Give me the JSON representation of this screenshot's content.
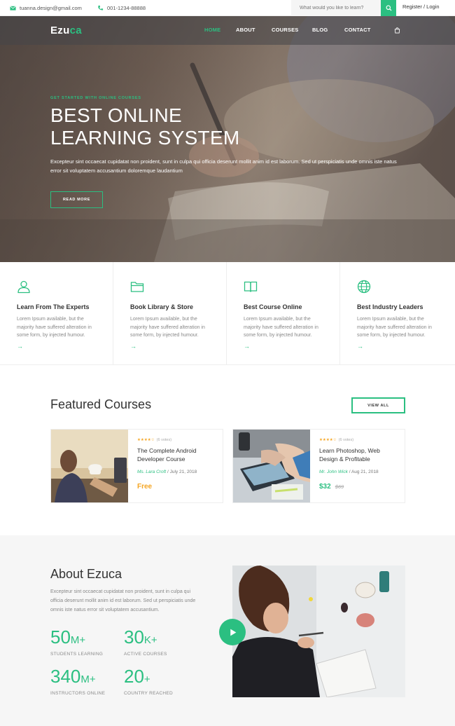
{
  "topbar": {
    "email": "tuanna.design@gmail.com",
    "phone": "001-1234-88888",
    "search_placeholder": "What would you like to learn?",
    "register_login": "Register / Login"
  },
  "nav": {
    "logo_a": "Ezu",
    "logo_b": "ca",
    "items": [
      "HOME",
      "ABOUT",
      "COURSES",
      "BLOG",
      "CONTACT"
    ]
  },
  "hero": {
    "eyebrow": "GET STARTED WITH ONLINE COURSES",
    "title": "BEST ONLINE LEARNING SYSTEM",
    "text": "Excepteur sint occaecat cupidatat non proident, sunt in culpa qui officia deserunt mollit anim id est laborum. Sed ut perspiciatis unde omnis iste natus error sit voluptatem accusantium doloremque laudantium",
    "button": "READ MORE"
  },
  "features": [
    {
      "title": "Learn From The Experts",
      "text": "Lorem Ipsum available, but the majority have suffered alteration in some form, by injected humour.",
      "icon": "user-icon"
    },
    {
      "title": "Book Library & Store",
      "text": "Lorem Ipsum available, but the majority have suffered alteration in some form, by injected humour.",
      "icon": "folder-icon"
    },
    {
      "title": "Best Course Online",
      "text": "Lorem Ipsum available, but the majority have suffered alteration in some form, by injected humour.",
      "icon": "book-icon"
    },
    {
      "title": "Best Industry Leaders",
      "text": "Lorem Ipsum available, but the majority have suffered alteration in some form, by injected humour.",
      "icon": "globe-icon"
    }
  ],
  "featured": {
    "title": "Featured Courses",
    "view_all": "VIEW ALL",
    "courses": [
      {
        "rating": 4,
        "votes": "(6 votes)",
        "title": "The Complete Android Developer Course",
        "author": "Ms. Lara Croft",
        "date": "/ July 21, 2018",
        "price": "Free",
        "old_price": ""
      },
      {
        "rating": 4,
        "votes": "(6 votes)",
        "title": "Learn Photoshop, Web Design & Profitable",
        "author": "Mr. John Wick",
        "date": "/ Aug 21, 2018",
        "price": "$32",
        "old_price": "$69"
      }
    ]
  },
  "about": {
    "title": "About Ezuca",
    "text": "Excepteur sint occaecat cupidatat non proident, sunt in culpa qui officia deserunt mollit anim id est laborum. Sed ut perspiciatis unde omnis iste natus error sit voluptatem accusantium.",
    "stats": [
      {
        "value": "50",
        "suffix": "M+",
        "label": "STUDENTS LEARNING"
      },
      {
        "value": "30",
        "suffix": "K+",
        "label": "ACTIVE COURSES"
      },
      {
        "value": "340",
        "suffix": "M+",
        "label": "INSTRUCTORS ONLINE"
      },
      {
        "value": "20",
        "suffix": "+",
        "label": "COUNTRY REACHED"
      }
    ]
  },
  "colors": {
    "accent": "#2bbf81",
    "star": "#f5a623",
    "free": "#f5a623"
  }
}
